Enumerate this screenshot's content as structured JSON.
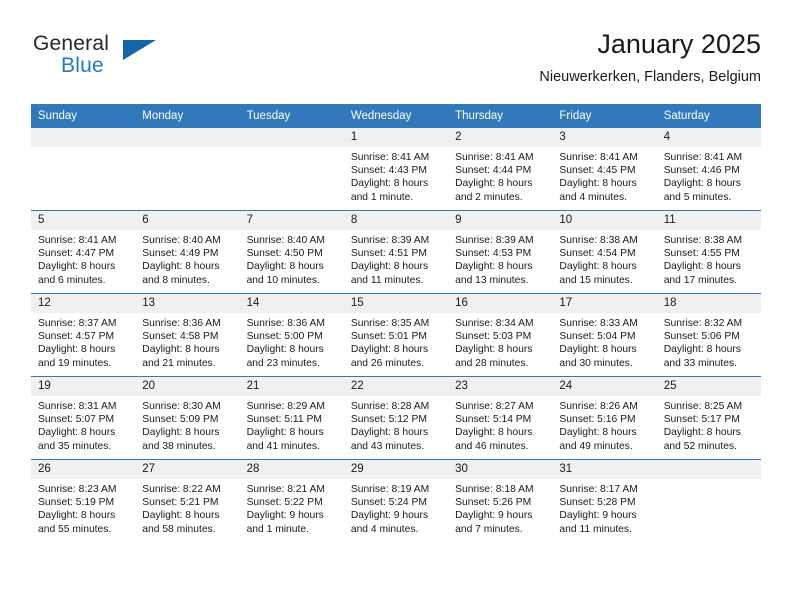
{
  "brand": {
    "name_primary": "General",
    "name_secondary": "Blue",
    "accent_color": "#1f7ac2",
    "triangle_color": "#1565a8"
  },
  "header": {
    "title": "January 2025",
    "subtitle": "Nieuwerkerken, Flanders, Belgium"
  },
  "calendar": {
    "header_bg": "#3279bb",
    "header_text_color": "#ffffff",
    "daynum_bg": "#f0f0f0",
    "weekday_headers": [
      "Sunday",
      "Monday",
      "Tuesday",
      "Wednesday",
      "Thursday",
      "Friday",
      "Saturday"
    ],
    "weeks": [
      [
        {
          "day": "",
          "empty": true,
          "sunrise": "",
          "sunset": "",
          "daylight": ""
        },
        {
          "day": "",
          "empty": true,
          "sunrise": "",
          "sunset": "",
          "daylight": ""
        },
        {
          "day": "",
          "empty": true,
          "sunrise": "",
          "sunset": "",
          "daylight": ""
        },
        {
          "day": "1",
          "empty": false,
          "sunrise": "Sunrise: 8:41 AM",
          "sunset": "Sunset: 4:43 PM",
          "daylight": "Daylight: 8 hours and 1 minute."
        },
        {
          "day": "2",
          "empty": false,
          "sunrise": "Sunrise: 8:41 AM",
          "sunset": "Sunset: 4:44 PM",
          "daylight": "Daylight: 8 hours and 2 minutes."
        },
        {
          "day": "3",
          "empty": false,
          "sunrise": "Sunrise: 8:41 AM",
          "sunset": "Sunset: 4:45 PM",
          "daylight": "Daylight: 8 hours and 4 minutes."
        },
        {
          "day": "4",
          "empty": false,
          "sunrise": "Sunrise: 8:41 AM",
          "sunset": "Sunset: 4:46 PM",
          "daylight": "Daylight: 8 hours and 5 minutes."
        }
      ],
      [
        {
          "day": "5",
          "empty": false,
          "sunrise": "Sunrise: 8:41 AM",
          "sunset": "Sunset: 4:47 PM",
          "daylight": "Daylight: 8 hours and 6 minutes."
        },
        {
          "day": "6",
          "empty": false,
          "sunrise": "Sunrise: 8:40 AM",
          "sunset": "Sunset: 4:49 PM",
          "daylight": "Daylight: 8 hours and 8 minutes."
        },
        {
          "day": "7",
          "empty": false,
          "sunrise": "Sunrise: 8:40 AM",
          "sunset": "Sunset: 4:50 PM",
          "daylight": "Daylight: 8 hours and 10 minutes."
        },
        {
          "day": "8",
          "empty": false,
          "sunrise": "Sunrise: 8:39 AM",
          "sunset": "Sunset: 4:51 PM",
          "daylight": "Daylight: 8 hours and 11 minutes."
        },
        {
          "day": "9",
          "empty": false,
          "sunrise": "Sunrise: 8:39 AM",
          "sunset": "Sunset: 4:53 PM",
          "daylight": "Daylight: 8 hours and 13 minutes."
        },
        {
          "day": "10",
          "empty": false,
          "sunrise": "Sunrise: 8:38 AM",
          "sunset": "Sunset: 4:54 PM",
          "daylight": "Daylight: 8 hours and 15 minutes."
        },
        {
          "day": "11",
          "empty": false,
          "sunrise": "Sunrise: 8:38 AM",
          "sunset": "Sunset: 4:55 PM",
          "daylight": "Daylight: 8 hours and 17 minutes."
        }
      ],
      [
        {
          "day": "12",
          "empty": false,
          "sunrise": "Sunrise: 8:37 AM",
          "sunset": "Sunset: 4:57 PM",
          "daylight": "Daylight: 8 hours and 19 minutes."
        },
        {
          "day": "13",
          "empty": false,
          "sunrise": "Sunrise: 8:36 AM",
          "sunset": "Sunset: 4:58 PM",
          "daylight": "Daylight: 8 hours and 21 minutes."
        },
        {
          "day": "14",
          "empty": false,
          "sunrise": "Sunrise: 8:36 AM",
          "sunset": "Sunset: 5:00 PM",
          "daylight": "Daylight: 8 hours and 23 minutes."
        },
        {
          "day": "15",
          "empty": false,
          "sunrise": "Sunrise: 8:35 AM",
          "sunset": "Sunset: 5:01 PM",
          "daylight": "Daylight: 8 hours and 26 minutes."
        },
        {
          "day": "16",
          "empty": false,
          "sunrise": "Sunrise: 8:34 AM",
          "sunset": "Sunset: 5:03 PM",
          "daylight": "Daylight: 8 hours and 28 minutes."
        },
        {
          "day": "17",
          "empty": false,
          "sunrise": "Sunrise: 8:33 AM",
          "sunset": "Sunset: 5:04 PM",
          "daylight": "Daylight: 8 hours and 30 minutes."
        },
        {
          "day": "18",
          "empty": false,
          "sunrise": "Sunrise: 8:32 AM",
          "sunset": "Sunset: 5:06 PM",
          "daylight": "Daylight: 8 hours and 33 minutes."
        }
      ],
      [
        {
          "day": "19",
          "empty": false,
          "sunrise": "Sunrise: 8:31 AM",
          "sunset": "Sunset: 5:07 PM",
          "daylight": "Daylight: 8 hours and 35 minutes."
        },
        {
          "day": "20",
          "empty": false,
          "sunrise": "Sunrise: 8:30 AM",
          "sunset": "Sunset: 5:09 PM",
          "daylight": "Daylight: 8 hours and 38 minutes."
        },
        {
          "day": "21",
          "empty": false,
          "sunrise": "Sunrise: 8:29 AM",
          "sunset": "Sunset: 5:11 PM",
          "daylight": "Daylight: 8 hours and 41 minutes."
        },
        {
          "day": "22",
          "empty": false,
          "sunrise": "Sunrise: 8:28 AM",
          "sunset": "Sunset: 5:12 PM",
          "daylight": "Daylight: 8 hours and 43 minutes."
        },
        {
          "day": "23",
          "empty": false,
          "sunrise": "Sunrise: 8:27 AM",
          "sunset": "Sunset: 5:14 PM",
          "daylight": "Daylight: 8 hours and 46 minutes."
        },
        {
          "day": "24",
          "empty": false,
          "sunrise": "Sunrise: 8:26 AM",
          "sunset": "Sunset: 5:16 PM",
          "daylight": "Daylight: 8 hours and 49 minutes."
        },
        {
          "day": "25",
          "empty": false,
          "sunrise": "Sunrise: 8:25 AM",
          "sunset": "Sunset: 5:17 PM",
          "daylight": "Daylight: 8 hours and 52 minutes."
        }
      ],
      [
        {
          "day": "26",
          "empty": false,
          "sunrise": "Sunrise: 8:23 AM",
          "sunset": "Sunset: 5:19 PM",
          "daylight": "Daylight: 8 hours and 55 minutes."
        },
        {
          "day": "27",
          "empty": false,
          "sunrise": "Sunrise: 8:22 AM",
          "sunset": "Sunset: 5:21 PM",
          "daylight": "Daylight: 8 hours and 58 minutes."
        },
        {
          "day": "28",
          "empty": false,
          "sunrise": "Sunrise: 8:21 AM",
          "sunset": "Sunset: 5:22 PM",
          "daylight": "Daylight: 9 hours and 1 minute."
        },
        {
          "day": "29",
          "empty": false,
          "sunrise": "Sunrise: 8:19 AM",
          "sunset": "Sunset: 5:24 PM",
          "daylight": "Daylight: 9 hours and 4 minutes."
        },
        {
          "day": "30",
          "empty": false,
          "sunrise": "Sunrise: 8:18 AM",
          "sunset": "Sunset: 5:26 PM",
          "daylight": "Daylight: 9 hours and 7 minutes."
        },
        {
          "day": "31",
          "empty": false,
          "sunrise": "Sunrise: 8:17 AM",
          "sunset": "Sunset: 5:28 PM",
          "daylight": "Daylight: 9 hours and 11 minutes."
        },
        {
          "day": "",
          "empty": true,
          "sunrise": "",
          "sunset": "",
          "daylight": ""
        }
      ]
    ]
  }
}
